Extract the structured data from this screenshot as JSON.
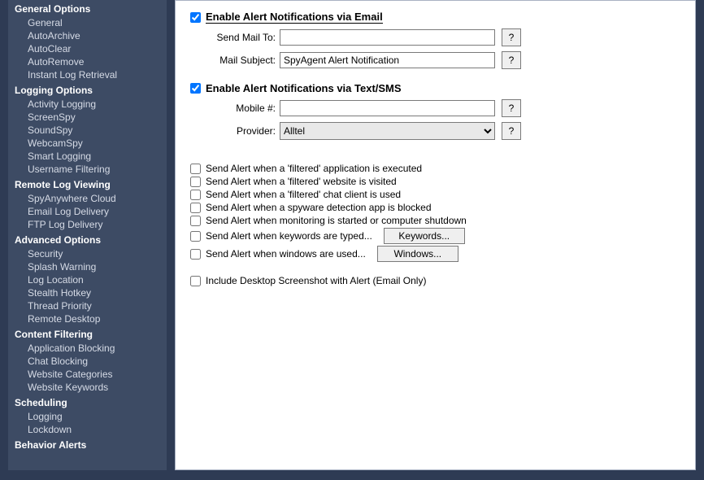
{
  "sidebar": {
    "sections": [
      {
        "title": "General Options",
        "items": [
          "General",
          "AutoArchive",
          "AutoClear",
          "AutoRemove",
          "Instant Log Retrieval"
        ]
      },
      {
        "title": "Logging Options",
        "items": [
          "Activity Logging",
          "ScreenSpy",
          "SoundSpy",
          "WebcamSpy",
          "Smart Logging",
          "Username Filtering"
        ]
      },
      {
        "title": "Remote Log Viewing",
        "items": [
          "SpyAnywhere Cloud",
          "Email Log Delivery",
          "FTP Log Delivery"
        ]
      },
      {
        "title": "Advanced Options",
        "items": [
          "Security",
          "Splash Warning",
          "Log Location",
          "Stealth Hotkey",
          "Thread Priority",
          "Remote Desktop"
        ]
      },
      {
        "title": "Content Filtering",
        "items": [
          "Application Blocking",
          "Chat Blocking",
          "Website Categories",
          "Website Keywords"
        ]
      },
      {
        "title": "Scheduling",
        "items": [
          "Logging",
          "Lockdown"
        ]
      },
      {
        "title": "Behavior Alerts",
        "items": []
      }
    ]
  },
  "main": {
    "email": {
      "checked": true,
      "title": "Enable Alert Notifications via Email",
      "sendTo": {
        "label": "Send Mail To:",
        "value": ""
      },
      "subject": {
        "label": "Mail Subject:",
        "value": "SpyAgent Alert Notification"
      }
    },
    "sms": {
      "checked": true,
      "title": "Enable Alert Notifications via Text/SMS",
      "mobile": {
        "label": "Mobile #:",
        "value": ""
      },
      "provider": {
        "label": "Provider:",
        "value": "Alltel",
        "options": [
          "Alltel"
        ]
      }
    },
    "alerts": [
      {
        "checked": false,
        "label": "Send Alert when a 'filtered' application is executed"
      },
      {
        "checked": false,
        "label": "Send Alert when a 'filtered' website is visited"
      },
      {
        "checked": false,
        "label": "Send Alert when a 'filtered' chat client is used"
      },
      {
        "checked": false,
        "label": "Send Alert when a spyware detection app is blocked"
      },
      {
        "checked": false,
        "label": "Send Alert when monitoring is started or computer shutdown"
      },
      {
        "checked": false,
        "label": "Send Alert when keywords are typed...",
        "button": "Keywords..."
      },
      {
        "checked": false,
        "label": "Send Alert when windows are used...",
        "button": "Windows..."
      }
    ],
    "screenshot": {
      "checked": false,
      "label": "Include Desktop Screenshot with Alert (Email Only)"
    },
    "helpLabel": "?"
  }
}
